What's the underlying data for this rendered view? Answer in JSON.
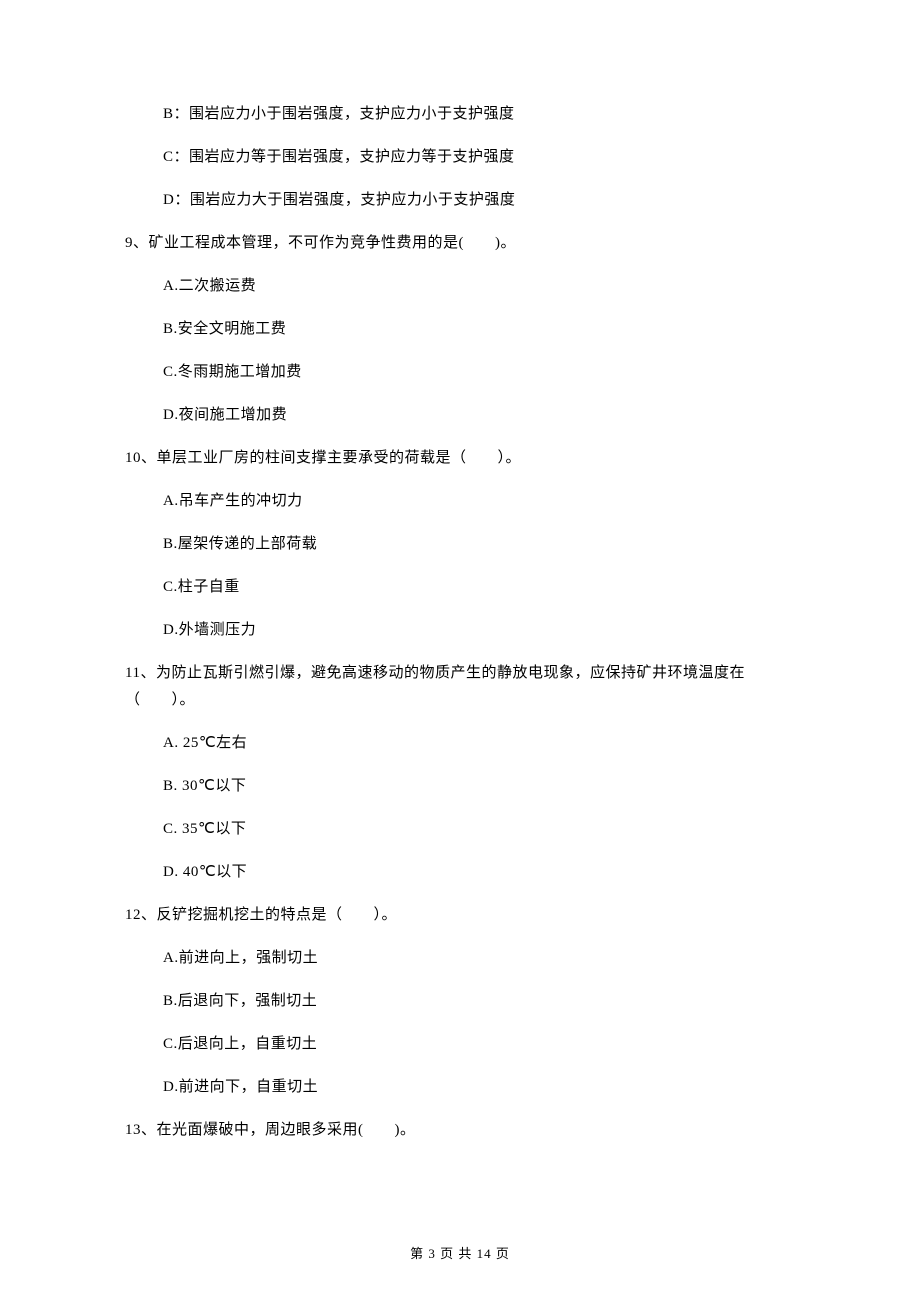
{
  "options_top": [
    "B：围岩应力小于围岩强度，支护应力小于支护强度",
    "C：围岩应力等于围岩强度，支护应力等于支护强度",
    "D：围岩应力大于围岩强度，支护应力小于支护强度"
  ],
  "q9": {
    "text": "9、矿业工程成本管理，不可作为竞争性费用的是(　　)。",
    "options": [
      "A.二次搬运费",
      "B.安全文明施工费",
      "C.冬雨期施工增加费",
      "D.夜间施工增加费"
    ]
  },
  "q10": {
    "text": "10、单层工业厂房的柱间支撑主要承受的荷载是（　　）。",
    "options": [
      "A.吊车产生的冲切力",
      "B.屋架传递的上部荷载",
      "C.柱子自重",
      "D.外墙测压力"
    ]
  },
  "q11": {
    "line1": "11、为防止瓦斯引燃引爆，避免高速移动的物质产生的静放电现象，应保持矿井环境温度在",
    "line2": "（　　）。",
    "options": [
      "A. 25℃左右",
      "B. 30℃以下",
      "C. 35℃以下",
      "D. 40℃以下"
    ]
  },
  "q12": {
    "text": "12、反铲挖掘机挖土的特点是（　　）。",
    "options": [
      "A.前进向上，强制切土",
      "B.后退向下，强制切土",
      "C.后退向上，自重切土",
      "D.前进向下，自重切土"
    ]
  },
  "q13": {
    "text": "13、在光面爆破中，周边眼多采用(　　)。"
  },
  "footer": "第 3 页 共 14 页"
}
